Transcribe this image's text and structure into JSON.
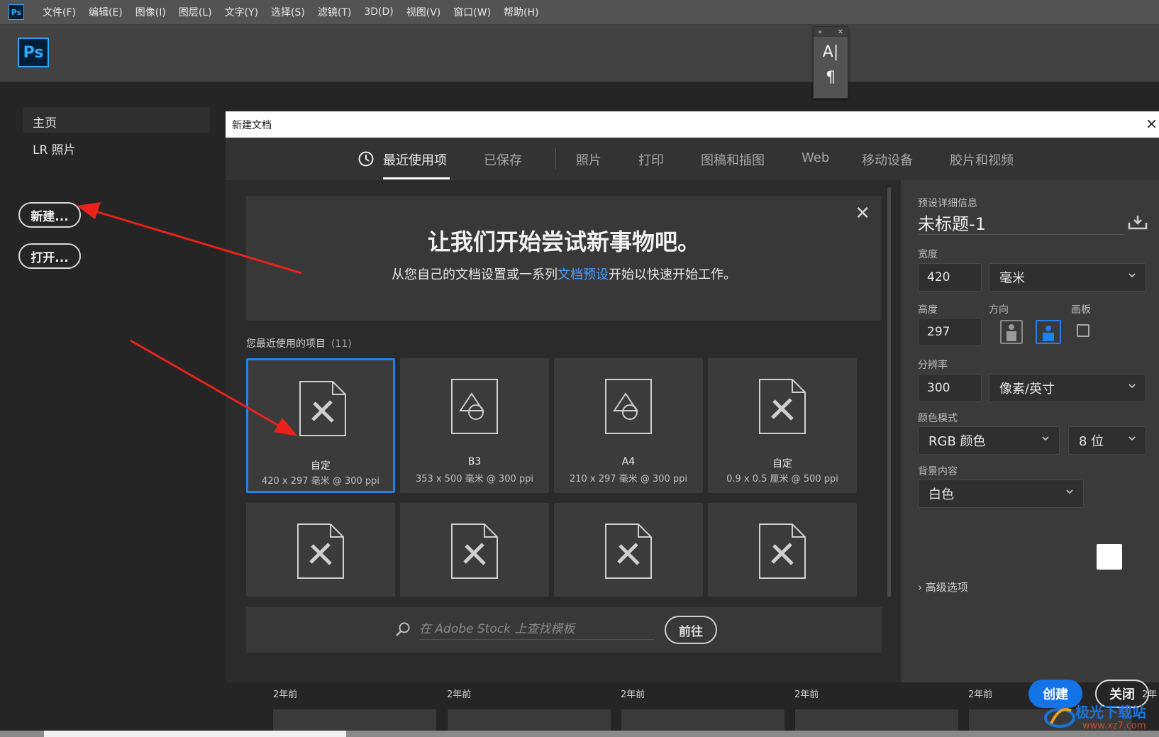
{
  "menubar": {
    "app_icon": "Ps",
    "items": [
      "文件(F)",
      "编辑(E)",
      "图像(I)",
      "图层(L)",
      "文字(Y)",
      "选择(S)",
      "滤镜(T)",
      "3D(D)",
      "视图(V)",
      "窗口(W)",
      "帮助(H)"
    ]
  },
  "logo": "Ps",
  "sidebar": {
    "home": "主页",
    "lr_photos": "LR 照片",
    "new_button": "新建...",
    "open_button": "打开..."
  },
  "dialog": {
    "title": "新建文档",
    "close": "×",
    "tabs": [
      {
        "label": "最近使用项",
        "icon": "clock-icon",
        "active": true
      },
      {
        "label": "已保存"
      },
      {
        "label": "照片"
      },
      {
        "label": "打印"
      },
      {
        "label": "图稿和插图"
      },
      {
        "label": "Web"
      },
      {
        "label": "移动设备"
      },
      {
        "label": "胶片和视频"
      }
    ],
    "banner": {
      "heading": "让我们开始尝试新事物吧。",
      "sub_before": "从您自己的文档设置或一系列",
      "sub_link": "文档预设",
      "sub_after": "开始以快速开始工作。",
      "close": "✕"
    },
    "recent": {
      "label": "您最近使用的项目",
      "count": "(11)",
      "cards": [
        {
          "name": "自定",
          "size": "420 x 297 毫米 @ 300 ppi",
          "icon": "custom-doc-icon",
          "selected": true
        },
        {
          "name": "B3",
          "size": "353 x 500 毫米 @ 300 ppi",
          "icon": "print-doc-icon"
        },
        {
          "name": "A4",
          "size": "210 x 297 毫米 @ 300 ppi",
          "icon": "print-doc-icon"
        },
        {
          "name": "自定",
          "size": "0.9 x 0.5 厘米 @ 500 ppi",
          "icon": "custom-doc-icon"
        },
        {
          "name": "",
          "size": "",
          "icon": "custom-doc-icon"
        },
        {
          "name": "",
          "size": "",
          "icon": "custom-doc-icon"
        },
        {
          "name": "",
          "size": "",
          "icon": "custom-doc-icon"
        },
        {
          "name": "",
          "size": "",
          "icon": "custom-doc-icon"
        }
      ]
    },
    "stock": {
      "placeholder": "在 Adobe Stock 上查找模板",
      "go": "前往"
    },
    "details": {
      "section": "预设详细信息",
      "doc_title": "未标题-1",
      "width_label": "宽度",
      "width": "420",
      "width_unit": "毫米",
      "height_label": "高度",
      "height": "297",
      "orientation_label": "方向",
      "orientation": "landscape",
      "artboard_label": "画板",
      "artboard_checked": false,
      "resolution_label": "分辨率",
      "resolution": "300",
      "resolution_unit": "像素/英寸",
      "color_mode_label": "颜色模式",
      "color_mode": "RGB 颜色",
      "bit_depth": "8 位",
      "bg_label": "背景内容",
      "bg": "白色",
      "bg_color": "#ffffff",
      "advanced": "高级选项",
      "create": "创建",
      "close": "关闭"
    }
  },
  "background_recent": {
    "times": [
      "2年前",
      "2年前",
      "2年前",
      "2年前",
      "2年前",
      "2年"
    ]
  },
  "watermark": {
    "line1": "极光下载站",
    "line2": "www.xz7.com"
  },
  "colors": {
    "accent": "#2680eb",
    "create_button": "#1473e6",
    "link": "#4a9fff",
    "annotation_arrow": "#e8231b"
  }
}
